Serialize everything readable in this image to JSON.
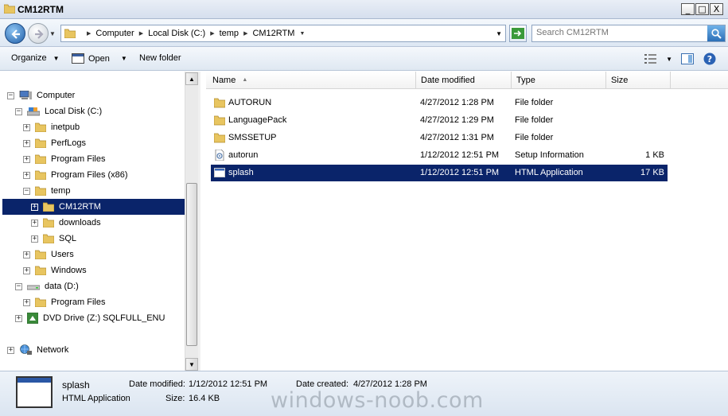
{
  "window": {
    "title": "CM12RTM",
    "controls": {
      "minimize": "_",
      "maximize": "□",
      "close": "X"
    }
  },
  "address_bar": {
    "breadcrumbs": [
      "Computer",
      "Local Disk (C:)",
      "temp",
      "CM12RTM"
    ]
  },
  "search": {
    "placeholder": "Search CM12RTM"
  },
  "toolbar": {
    "organize": "Organize",
    "open": "Open",
    "new_folder": "New folder"
  },
  "tree": {
    "computer": "Computer",
    "local_disk": "Local Disk (C:)",
    "inetpub": "inetpub",
    "perflogs": "PerfLogs",
    "program_files": "Program Files",
    "program_files_x86": "Program Files (x86)",
    "temp": "temp",
    "cm12rtm": "CM12RTM",
    "downloads": "downloads",
    "sql": "SQL",
    "users": "Users",
    "windows": "Windows",
    "data_drive": "data (D:)",
    "data_program_files": "Program Files",
    "dvd_drive": "DVD Drive (Z:) SQLFULL_ENU",
    "network": "Network"
  },
  "columns": {
    "name": "Name",
    "date_modified": "Date modified",
    "type": "Type",
    "size": "Size"
  },
  "files": [
    {
      "name": "AUTORUN",
      "date": "4/27/2012 1:28 PM",
      "type": "File folder",
      "size": ""
    },
    {
      "name": "LanguagePack",
      "date": "4/27/2012 1:29 PM",
      "type": "File folder",
      "size": ""
    },
    {
      "name": "SMSSETUP",
      "date": "4/27/2012 1:31 PM",
      "type": "File folder",
      "size": ""
    },
    {
      "name": "autorun",
      "date": "1/12/2012 12:51 PM",
      "type": "Setup Information",
      "size": "1 KB"
    },
    {
      "name": "splash",
      "date": "1/12/2012 12:51 PM",
      "type": "HTML Application",
      "size": "17 KB"
    }
  ],
  "details": {
    "name": "splash",
    "type": "HTML Application",
    "date_modified_label": "Date modified:",
    "date_modified": "1/12/2012 12:51 PM",
    "date_created_label": "Date created:",
    "date_created": "4/27/2012 1:28 PM",
    "size_label": "Size:",
    "size": "16.4 KB"
  },
  "watermark": "windows-noob.com",
  "colors": {
    "selection": "#0a246a",
    "folder": "#e8c560"
  }
}
